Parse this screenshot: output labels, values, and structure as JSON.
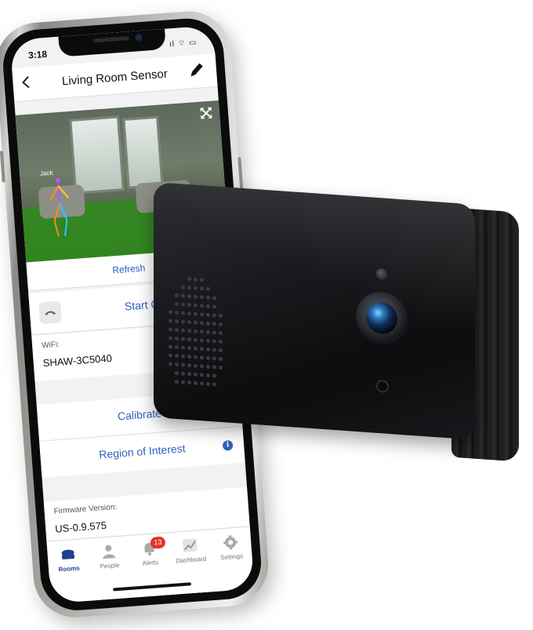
{
  "status_bar": {
    "time": "3:18",
    "icons": "ıl ⌔ ▭"
  },
  "header": {
    "title": "Living Room Sensor",
    "back_icon": "chevron-left-icon",
    "edit_icon": "pencil-icon"
  },
  "camera": {
    "person_label": "Jack",
    "expand_icon": "expand-icon"
  },
  "actions": {
    "refresh_label": "Refresh",
    "start_call_label": "Start Call",
    "calibrate_label": "Calibrate",
    "region_label": "Region of Interest",
    "info_glyph": "i"
  },
  "wifi": {
    "caption": "WiFi:",
    "value": "SHAW-3C5040"
  },
  "firmware": {
    "caption": "Firmware Version:",
    "value": "US-0.9.575"
  },
  "tabs": [
    {
      "label": "Rooms",
      "icon": "rooms-icon",
      "active": true
    },
    {
      "label": "People",
      "icon": "person-icon",
      "active": false
    },
    {
      "label": "Alerts",
      "icon": "bell-icon",
      "active": false,
      "badge": "13"
    },
    {
      "label": "Dashboard",
      "icon": "chart-icon",
      "active": false
    },
    {
      "label": "Settings",
      "icon": "gear-icon",
      "active": false
    }
  ],
  "colors": {
    "accent": "#2e5fb8",
    "badge": "#e2332a",
    "device": "#111113"
  }
}
